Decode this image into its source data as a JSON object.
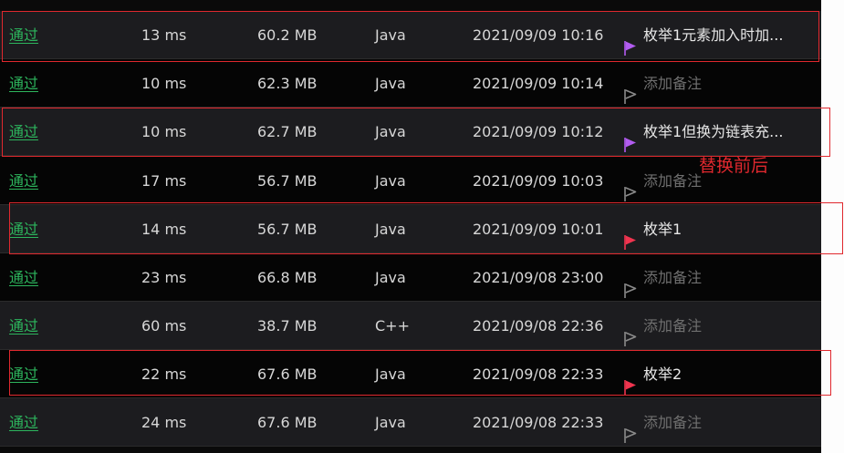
{
  "submissions": [
    {
      "status": "通过",
      "runtime": "13 ms",
      "memory": "60.2 MB",
      "language": "Java",
      "submitted_at": "2021/09/09 10:16",
      "note": "枚举1元素加入时加...",
      "note_placeholder": false,
      "flag_color": "#b25cf0"
    },
    {
      "status": "通过",
      "runtime": "10 ms",
      "memory": "62.3 MB",
      "language": "Java",
      "submitted_at": "2021/09/09 10:14",
      "note": "添加备注",
      "note_placeholder": true,
      "flag_color": "#8a8a8a"
    },
    {
      "status": "通过",
      "runtime": "10 ms",
      "memory": "62.7 MB",
      "language": "Java",
      "submitted_at": "2021/09/09 10:12",
      "note": "枚举1但换为链表充...",
      "note_placeholder": false,
      "flag_color": "#b25cf0"
    },
    {
      "status": "通过",
      "runtime": "17 ms",
      "memory": "56.7 MB",
      "language": "Java",
      "submitted_at": "2021/09/09 10:03",
      "note": "添加备注",
      "note_placeholder": true,
      "flag_color": "#8a8a8a"
    },
    {
      "status": "通过",
      "runtime": "14 ms",
      "memory": "56.7 MB",
      "language": "Java",
      "submitted_at": "2021/09/09 10:01",
      "note": "枚举1",
      "note_placeholder": false,
      "flag_color": "#f0344f"
    },
    {
      "status": "通过",
      "runtime": "23 ms",
      "memory": "66.8 MB",
      "language": "Java",
      "submitted_at": "2021/09/08 23:00",
      "note": "添加备注",
      "note_placeholder": true,
      "flag_color": "#8a8a8a"
    },
    {
      "status": "通过",
      "runtime": "60 ms",
      "memory": "38.7 MB",
      "language": "C++",
      "submitted_at": "2021/09/08 22:36",
      "note": "添加备注",
      "note_placeholder": true,
      "flag_color": "#8a8a8a"
    },
    {
      "status": "通过",
      "runtime": "22 ms",
      "memory": "67.6 MB",
      "language": "Java",
      "submitted_at": "2021/09/08 22:33",
      "note": "枚举2",
      "note_placeholder": false,
      "flag_color": "#f0344f"
    },
    {
      "status": "通过",
      "runtime": "24 ms",
      "memory": "67.6 MB",
      "language": "Java",
      "submitted_at": "2021/09/08 22:33",
      "note": "添加备注",
      "note_placeholder": true,
      "flag_color": "#8a8a8a"
    }
  ],
  "annotation": {
    "label": "替换前后",
    "color": "#e0282e"
  },
  "colors": {
    "status_accepted": "#2db55d",
    "row_alt": "#1c1c1f",
    "row_base": "#050505"
  },
  "icons": {
    "note_flag": "flag-icon"
  }
}
